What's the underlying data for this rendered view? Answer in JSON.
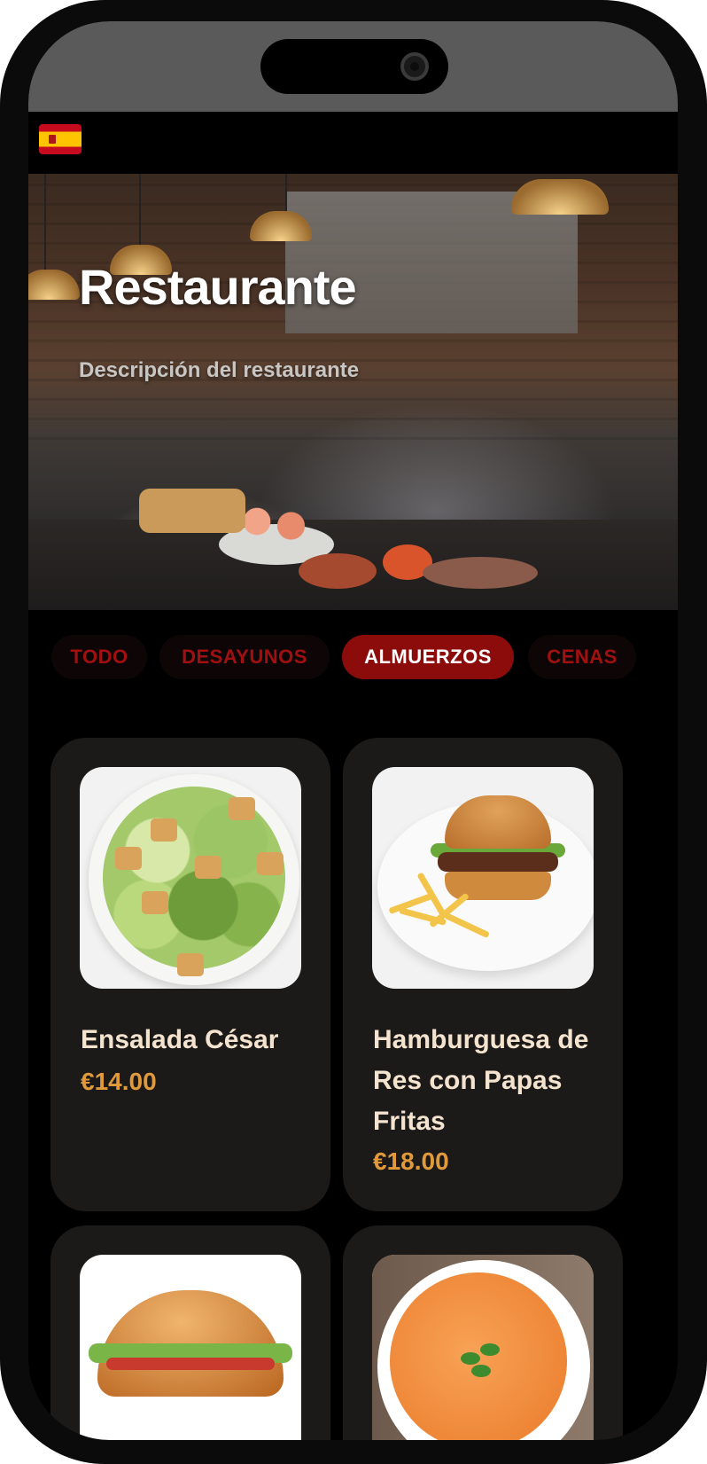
{
  "hero": {
    "title": "Restaurante",
    "description": "Descripción del restaurante"
  },
  "language": {
    "flag": "spain-flag-icon"
  },
  "categories": [
    {
      "label": "TODO",
      "active": false
    },
    {
      "label": "DESAYUNOS",
      "active": false
    },
    {
      "label": "ALMUERZOS",
      "active": true
    },
    {
      "label": "CENAS",
      "active": false
    }
  ],
  "menu_items": [
    {
      "name": "Ensalada César",
      "price": "€14.00",
      "image": "caesar-salad-image"
    },
    {
      "name": "Hamburguesa de Res con Papas Fritas",
      "price": "€18.00",
      "image": "burger-fries-image"
    },
    {
      "name": "",
      "price": "",
      "image": "sandwich-image"
    },
    {
      "name": "",
      "price": "",
      "image": "tomato-soup-image"
    }
  ],
  "colors": {
    "accent": "#8c0c0c",
    "tab_text": "#a01010",
    "card_bg": "#1c1a18",
    "item_name": "#f3e3cf",
    "price": "#e09a3c"
  }
}
